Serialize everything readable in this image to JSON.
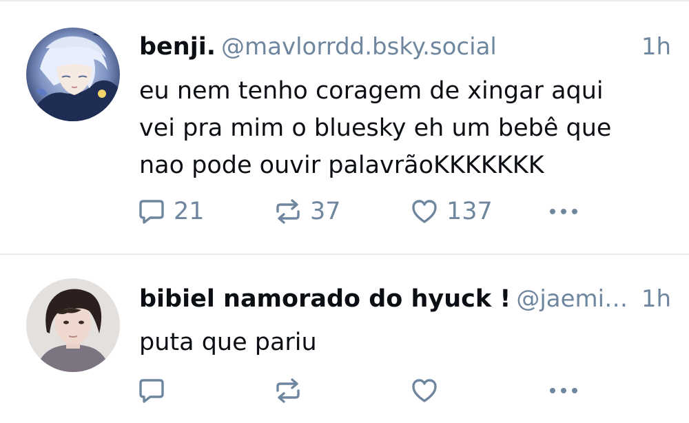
{
  "colors": {
    "text_primary": "#0b0f14",
    "text_secondary": "#6f869f",
    "divider": "#e6ebef",
    "background": "#ffffff"
  },
  "posts": [
    {
      "display_name": "benji.",
      "handle": "@mavlorrdd.bsky.social",
      "time": "1h",
      "text_lines": [
        "eu nem tenho coragem de xingar aqui",
        "vei pra mim o bluesky eh um bebê que",
        "nao pode ouvir palavrãoKKKKKKK"
      ],
      "avatar_icon": "anime-avatar",
      "reply_count": "21",
      "repost_count": "37",
      "like_count": "137",
      "icons": [
        "reply-icon",
        "repost-icon",
        "like-icon",
        "more-icon"
      ]
    },
    {
      "display_name": "bibiel namorado do hyuck !",
      "handle": "@jaemi…",
      "time": "1h",
      "text_lines": [
        "puta que pariu"
      ],
      "avatar_icon": "photo-avatar",
      "reply_count": "",
      "repost_count": "",
      "like_count": "",
      "icons": [
        "reply-icon",
        "repost-icon",
        "like-icon",
        "more-icon"
      ]
    }
  ]
}
